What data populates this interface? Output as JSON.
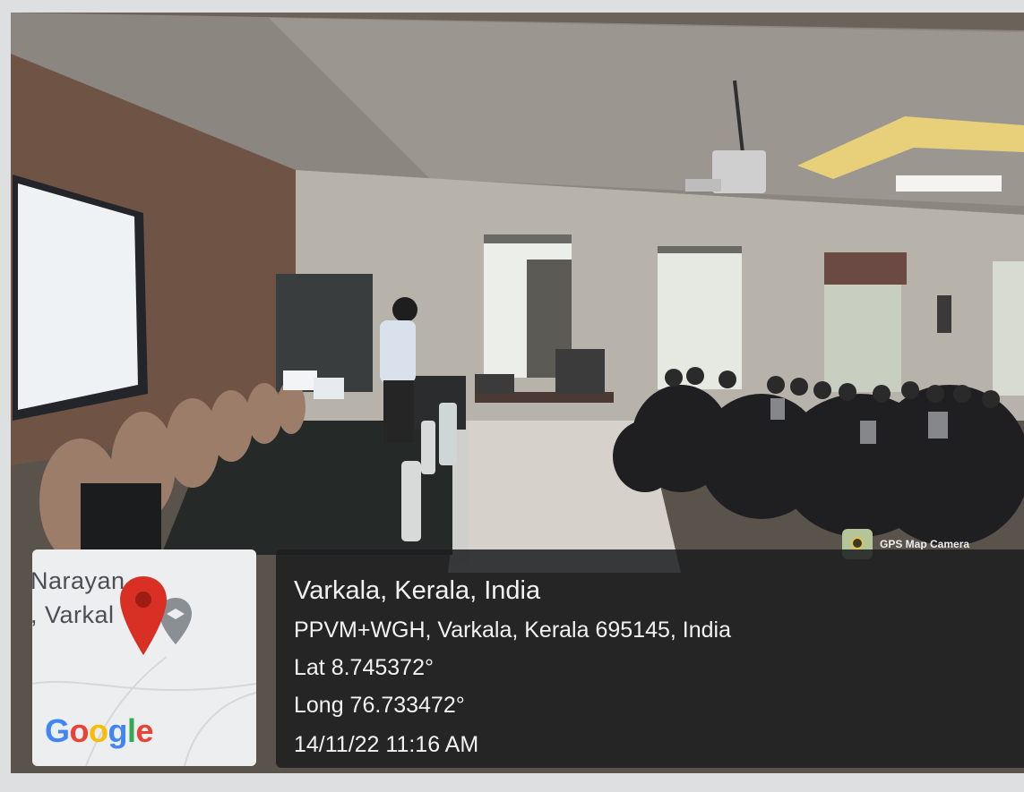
{
  "photo": {
    "scene": "classroom-seminar-photo"
  },
  "map_thumbnail": {
    "place_line1": "Narayan",
    "place_line2": ", Varkal",
    "logo": {
      "G": "G",
      "o1": "o",
      "o2": "o",
      "g": "g",
      "l": "l",
      "e": "e"
    },
    "pin_icon": "location-pin-icon",
    "pin_color": "#d93025"
  },
  "gps_badge": {
    "label": "GPS Map Camera",
    "icon": "gps-map-camera-icon"
  },
  "info": {
    "location": "Varkala, Kerala, India",
    "address": "PPVM+WGH, Varkala, Kerala 695145, India",
    "latitude": "Lat 8.745372°",
    "longitude": "Long 76.733472°",
    "datetime": "14/11/22 11:16 AM"
  }
}
